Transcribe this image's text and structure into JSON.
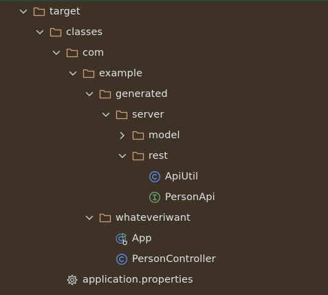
{
  "colors": {
    "background": "#3c3226",
    "text": "#dfe1e5",
    "chevron": "#c9ccd1",
    "folder": "#d39e7e",
    "class_icon": "#5a92f2",
    "interface_icon": "#6aad73",
    "run_marker": "#5fb865",
    "gear": "#c9ccd1"
  },
  "tree": {
    "nodes": [
      {
        "label": "target",
        "icon": "folder-icon",
        "expanded": true
      },
      {
        "label": "classes",
        "icon": "folder-icon",
        "expanded": true
      },
      {
        "label": "com",
        "icon": "folder-icon",
        "expanded": true
      },
      {
        "label": "example",
        "icon": "folder-icon",
        "expanded": true
      },
      {
        "label": "generated",
        "icon": "folder-icon",
        "expanded": true
      },
      {
        "label": "server",
        "icon": "folder-icon",
        "expanded": true
      },
      {
        "label": "model",
        "icon": "folder-icon",
        "expanded": false
      },
      {
        "label": "rest",
        "icon": "folder-icon",
        "expanded": true
      },
      {
        "label": "ApiUtil",
        "icon": "class-icon"
      },
      {
        "label": "PersonApi",
        "icon": "interface-icon"
      },
      {
        "label": "whateveriwant",
        "icon": "folder-icon",
        "expanded": true
      },
      {
        "label": "App",
        "icon": "runnable-class-icon"
      },
      {
        "label": "PersonController",
        "icon": "class-icon"
      },
      {
        "label": "application.properties",
        "icon": "gear-icon"
      }
    ]
  }
}
